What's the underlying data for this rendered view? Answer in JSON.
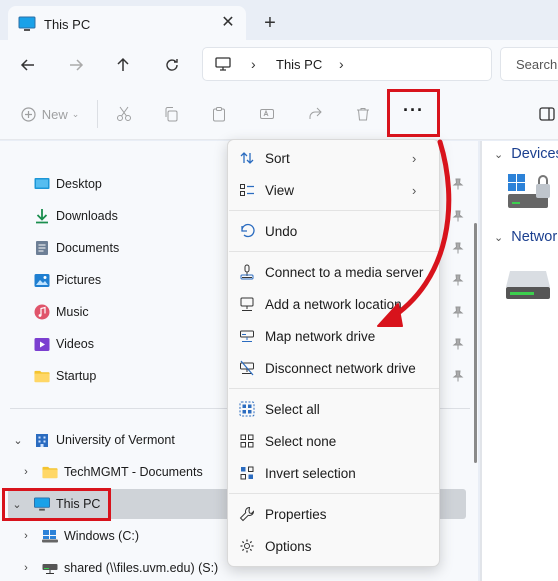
{
  "tab": {
    "title": "This PC",
    "close": "✕",
    "new_tab": "+"
  },
  "address": {
    "location": "This PC",
    "search_placeholder": "Search"
  },
  "toolbar": {
    "new_label": "New",
    "more": "···"
  },
  "quick_access": [
    {
      "label": "Desktop",
      "icon": "desktop-icon"
    },
    {
      "label": "Downloads",
      "icon": "downloads-icon"
    },
    {
      "label": "Documents",
      "icon": "documents-icon"
    },
    {
      "label": "Pictures",
      "icon": "pictures-icon"
    },
    {
      "label": "Music",
      "icon": "music-icon"
    },
    {
      "label": "Videos",
      "icon": "videos-icon"
    },
    {
      "label": "Startup",
      "icon": "folder-icon"
    }
  ],
  "tree": {
    "org": "University of Vermont",
    "techmgmt": "TechMGMT - Documents",
    "thispc": "This PC",
    "windows": "Windows (C:)",
    "shared": "shared (\\\\files.uvm.edu) (S:)"
  },
  "content": {
    "devices_label": "Devices",
    "network_label": "Network"
  },
  "menu": {
    "sort": "Sort",
    "view": "View",
    "undo": "Undo",
    "connect_media": "Connect to a media server",
    "add_network": "Add a network location",
    "map_drive": "Map network drive",
    "disconnect_drive": "Disconnect network drive",
    "select_all": "Select all",
    "select_none": "Select none",
    "invert_selection": "Invert selection",
    "properties": "Properties",
    "options": "Options"
  },
  "colors": {
    "highlight_red": "#d8131c",
    "accent_blue": "#1b3f8f",
    "folder_yellow": "#f4c430"
  }
}
